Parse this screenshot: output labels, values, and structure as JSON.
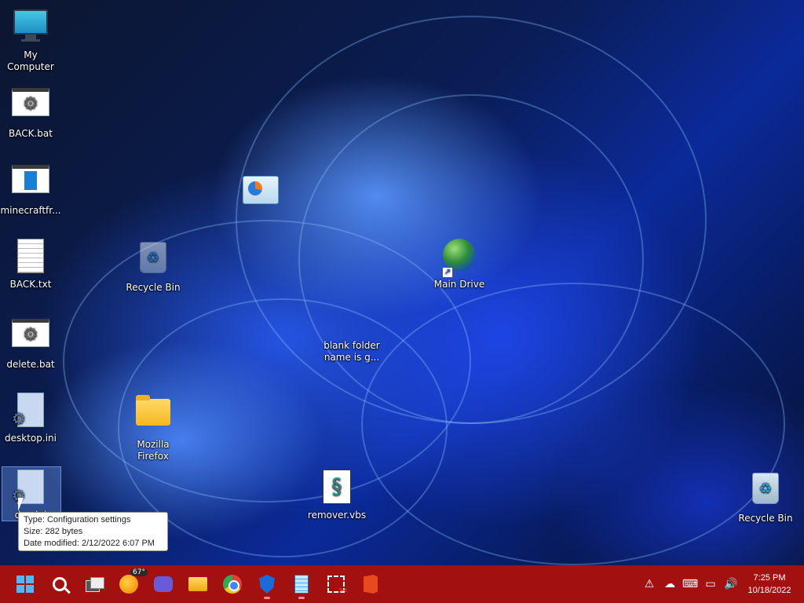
{
  "desktop": {
    "icons": [
      {
        "label": "My Computer"
      },
      {
        "label": "BACK.bat"
      },
      {
        "label": "minecraftfr..."
      },
      {
        "label": "BACK.txt"
      },
      {
        "label": "delete.bat"
      },
      {
        "label": "desktop.ini"
      },
      {
        "label": "de...ini"
      },
      {
        "label": "Recycle Bin"
      },
      {
        "label": "Mozilla Firefox"
      },
      {
        "label": "Main Drive"
      },
      {
        "label": "blank folder name is g..."
      },
      {
        "label": "remover.vbs"
      },
      {
        "label": "Recycle Bin"
      }
    ]
  },
  "tooltip": {
    "type": "Type: Configuration settings",
    "size": "Size: 282 bytes",
    "modified": "Date modified: 2/12/2022 6:07 PM"
  },
  "taskbar": {
    "weather_temp": "67°",
    "apps": [
      "start",
      "search",
      "task-view",
      "weather",
      "meet",
      "file-explorer",
      "chrome",
      "defender",
      "notepad",
      "snipping-tool",
      "office"
    ],
    "accent": "#a31010"
  },
  "tray": {
    "time": "7:25 PM",
    "date": "10/18/2022"
  }
}
